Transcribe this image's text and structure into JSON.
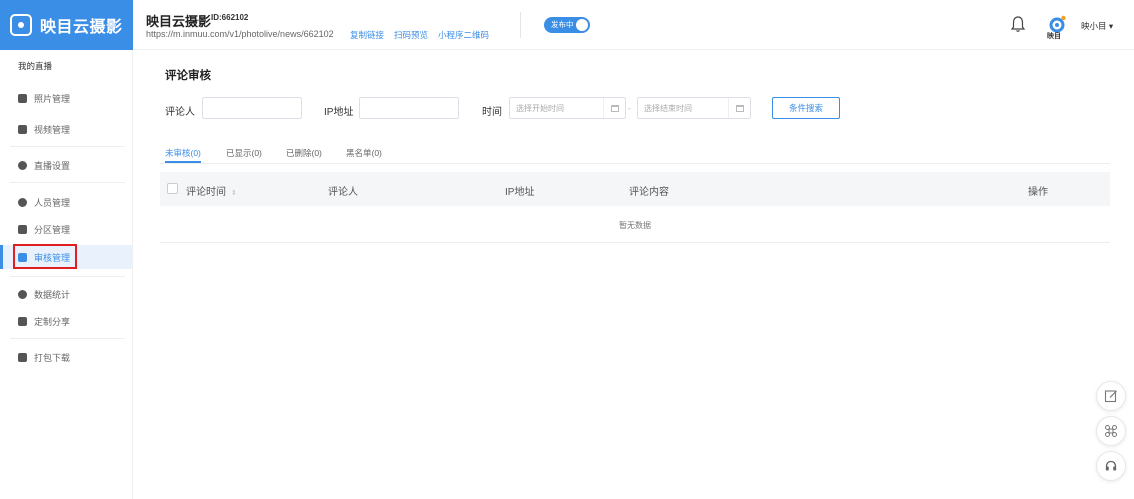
{
  "logo": {
    "text": "映目云摄影"
  },
  "header": {
    "album_name": "映目云摄影",
    "album_id": "ID:662102",
    "url": "https://m.inmuu.com/v1/photolive/news/662102",
    "links": {
      "copy": "复制链接",
      "preview": "扫码预览",
      "mini_qr": "小程序二维码"
    },
    "publish_toggle": {
      "label": "发布中",
      "on": true
    },
    "avatar_label": "映目",
    "user_name": "映小目 ▾"
  },
  "sidebar": {
    "title": "我的直播",
    "items": [
      {
        "label": "照片管理",
        "icon": "image-icon"
      },
      {
        "label": "视频管理",
        "icon": "video-icon"
      },
      {
        "label": "直播设置",
        "icon": "settings-icon"
      },
      {
        "label": "人员管理",
        "icon": "user-icon"
      },
      {
        "label": "分区管理",
        "icon": "partition-icon"
      },
      {
        "label": "审核管理",
        "icon": "review-icon",
        "active": true
      },
      {
        "label": "数据统计",
        "icon": "chart-icon"
      },
      {
        "label": "定制分享",
        "icon": "share-icon"
      },
      {
        "label": "打包下载",
        "icon": "download-icon"
      }
    ]
  },
  "main": {
    "title": "评论审核",
    "filters": {
      "commenter_label": "评论人",
      "ip_label": "IP地址",
      "time_label": "时间",
      "start_placeholder": "选择开始时间",
      "end_placeholder": "选择结束时间",
      "dash": "-",
      "search_button": "条件搜索"
    },
    "tabs": [
      "未审核(0)",
      "已显示(0)",
      "已删除(0)",
      "黑名单(0)"
    ],
    "table": {
      "headers": [
        "评论时间",
        "评论人",
        "IP地址",
        "评论内容",
        "操作"
      ],
      "sort_glyph": "⇕",
      "empty": "暂无数据"
    }
  },
  "colors": {
    "accent": "#3a8ee6",
    "highlight": "#e02020"
  }
}
